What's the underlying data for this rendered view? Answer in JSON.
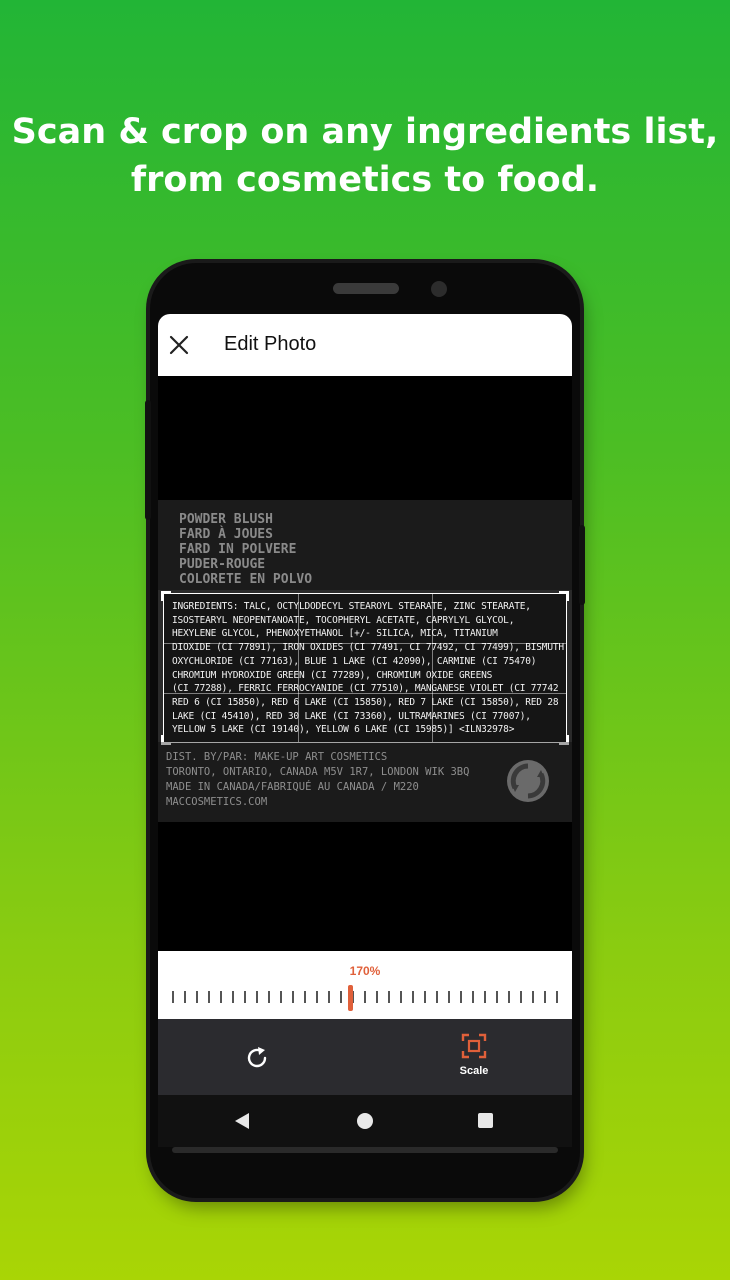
{
  "promo": {
    "headline_line1": "Scan & crop on any ingredients list,",
    "headline_line2": "from cosmetics to food."
  },
  "appbar": {
    "title": "Edit Photo",
    "close_icon": "close-icon"
  },
  "photo": {
    "product_lines": [
      "POWDER BLUSH",
      "FARD À JOUES",
      "FARD IN POLVERE",
      "PUDER-ROUGE",
      "COLORETE EN POLVO"
    ],
    "ingredient_lines": [
      "INGREDIENTS: TALC, OCTYLDODECYL STEAROYL STEARATE, ZINC STEARATE,",
      "ISOSTEARYL NEOPENTANOATE, TOCOPHERYL ACETATE, CAPRYLYL GLYCOL,",
      "HEXYLENE GLYCOL, PHENOXYETHANOL [+/- SILICA, MICA, TITANIUM",
      "DIOXIDE (CI 77891), IRON OXIDES (CI 77491, CI 77492, CI 77499), BISMUTH",
      "OXYCHLORIDE (CI 77163), BLUE 1 LAKE (CI 42090), CARMINE (CI 75470)",
      "CHROMIUM HYDROXIDE GREEN (CI 77289), CHROMIUM OXIDE GREENS",
      "(CI 77288), FERRIC FERROCYANIDE (CI 77510), MANGANESE VIOLET (CI 77742",
      "RED 6 (CI 15850), RED 6 LAKE (CI 15850), RED 7 LAKE (CI 15850), RED 28",
      "LAKE (CI 45410), RED 30 LAKE (CI 73360), ULTRAMARINES (CI 77007),",
      "YELLOW 5 LAKE (CI 19140), YELLOW 6 LAKE (CI 15985)] <ILN32978>"
    ],
    "dist_lines": [
      "DIST. BY/PAR: MAKE-UP ART COSMETICS",
      "TORONTO, ONTARIO, CANADA M5V 1R7, LONDON WIK 3BQ",
      "MADE IN CANADA/FABRIQUÉ AU CANADA / M220",
      "MACCOSMETICS.COM"
    ]
  },
  "zoom": {
    "label": "170%",
    "level_percent": 170,
    "accent_color": "#e0603a"
  },
  "toolbar": {
    "rotate_icon": "rotate-icon",
    "scale_icon": "scale-icon",
    "scale_label": "Scale"
  },
  "navbar": {
    "back_icon": "back-triangle-icon",
    "home_icon": "home-circle-icon",
    "recent_icon": "recents-square-icon"
  }
}
